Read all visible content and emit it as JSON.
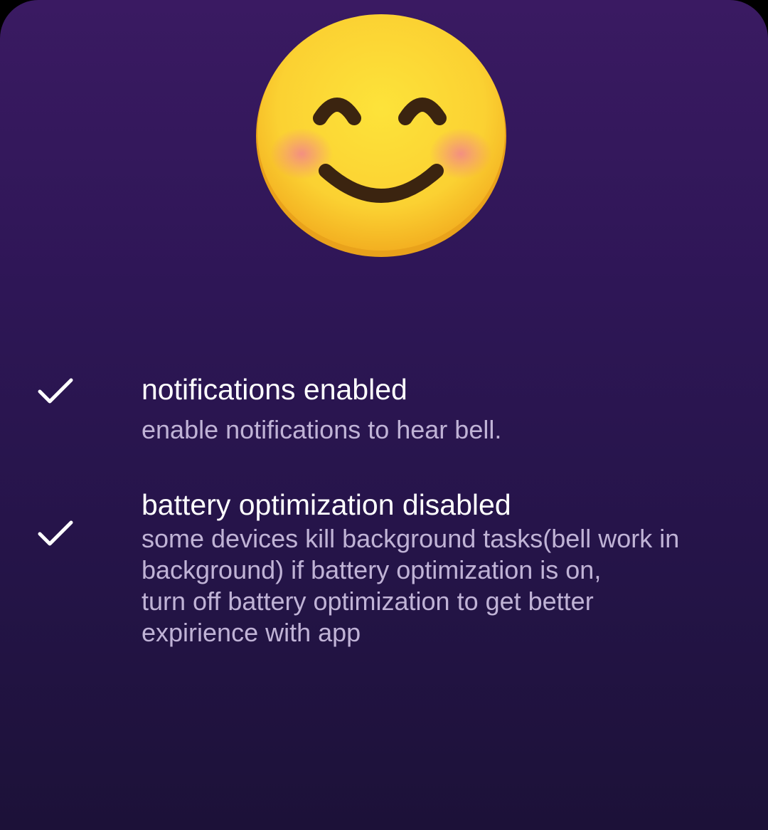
{
  "colors": {
    "background_top": "#3a1a62",
    "background_bottom": "#1c1138",
    "title_text": "#ffffff",
    "description_text": "#c0b3d6",
    "check": "#ffffff"
  },
  "header": {
    "icon": "smiling-face-with-smiling-eyes-emoji"
  },
  "checklist": [
    {
      "icon": "check-icon",
      "checked": true,
      "title": "notifications enabled",
      "description_lines": [
        "enable notifications to hear bell."
      ]
    },
    {
      "icon": "check-icon",
      "checked": true,
      "title": "battery optimization disabled",
      "description_lines": [
        "some devices kill background tasks(bell work in",
        "background) if battery optimization is on,",
        "turn off battery optimization to get better",
        "expirience with app"
      ]
    }
  ]
}
